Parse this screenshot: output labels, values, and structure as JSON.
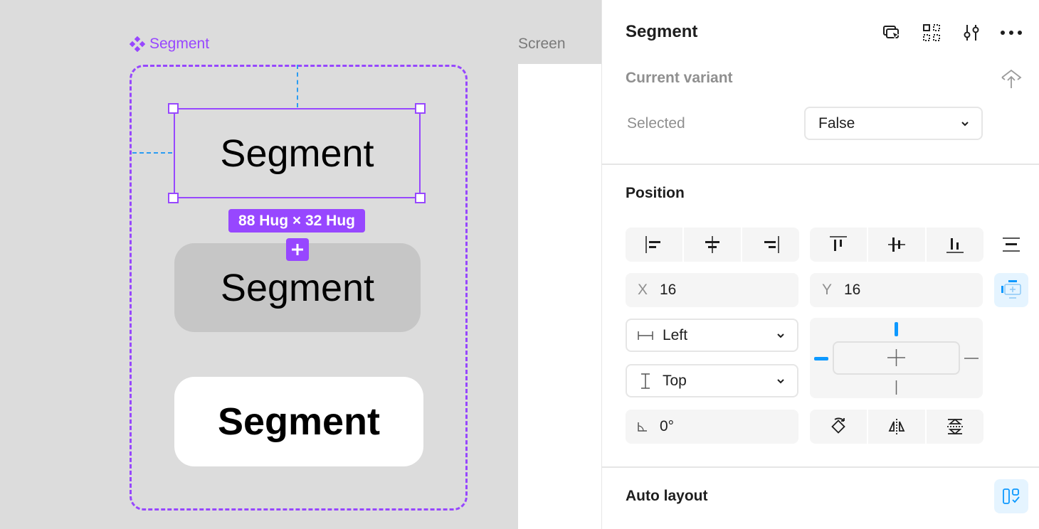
{
  "canvas": {
    "frame_label": "Segment",
    "screen_label": "Screen",
    "segments": [
      "Segment",
      "Segment",
      "Segment"
    ],
    "size_badge": "88 Hug × 32 Hug",
    "accent_color": "#9747ff",
    "spacing_color": "#2b9cf2"
  },
  "panel": {
    "title": "Segment",
    "header_icons": [
      "select-matching-icon",
      "components-grid-icon",
      "adjust-sliders-icon",
      "more-icon"
    ],
    "current_variant": {
      "label": "Current variant",
      "property_label": "Selected",
      "property_value": "False"
    },
    "position": {
      "title": "Position",
      "x_label": "X",
      "x_value": "16",
      "y_label": "Y",
      "y_value": "16",
      "horizontal_constraint": "Left",
      "vertical_constraint": "Top",
      "rotation": "0°"
    },
    "auto_layout": {
      "title": "Auto layout"
    },
    "active_color": "#e5f4ff",
    "active_icon_color": "#0d99ff"
  }
}
